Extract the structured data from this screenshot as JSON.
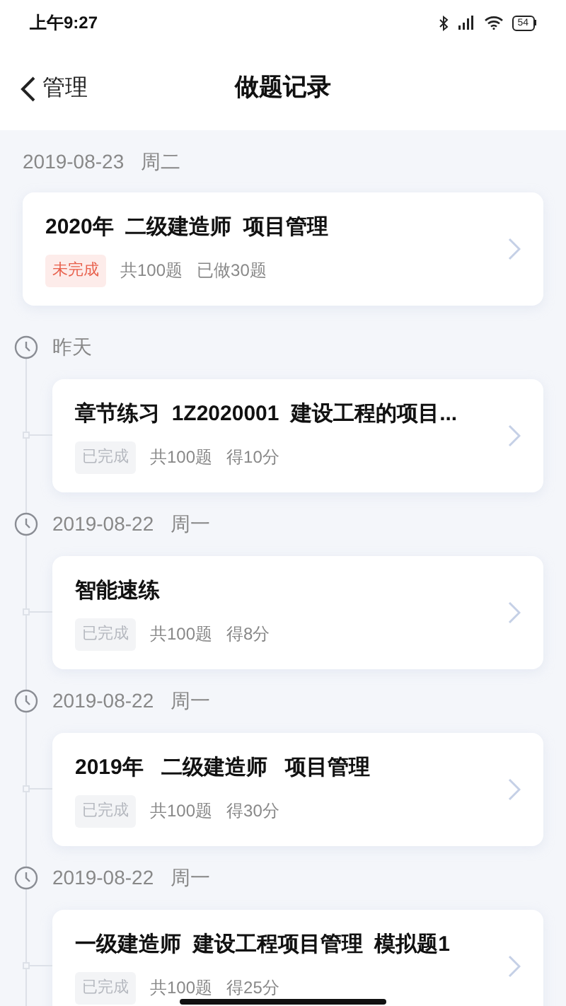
{
  "status_bar": {
    "time": "上午9:27",
    "battery": "54"
  },
  "nav": {
    "back_label": "管理",
    "title": "做题记录"
  },
  "top_group": {
    "date": "2019-08-23",
    "weekday": "周二",
    "card": {
      "title": "2020年  二级建造师  项目管理",
      "status": {
        "text": "未完成",
        "kind": "incomplete"
      },
      "total": "共100题",
      "result": "已做30题"
    }
  },
  "timeline": [
    {
      "date": "昨天",
      "card": {
        "title": "章节练习  1Z2020001  建设工程的项目...",
        "status": {
          "text": "已完成",
          "kind": "complete"
        },
        "total": "共100题",
        "result": "得10分"
      }
    },
    {
      "date": "2019-08-22",
      "weekday": "周一",
      "card": {
        "title": "智能速练",
        "status": {
          "text": "已完成",
          "kind": "complete"
        },
        "total": "共100题",
        "result": "得8分"
      }
    },
    {
      "date": "2019-08-22",
      "weekday": "周一",
      "card": {
        "title": "2019年   二级建造师   项目管理",
        "status": {
          "text": "已完成",
          "kind": "complete"
        },
        "total": "共100题",
        "result": "得30分"
      }
    },
    {
      "date": "2019-08-22",
      "weekday": "周一",
      "card": {
        "title": "一级建造师  建设工程项目管理  模拟题1",
        "status": {
          "text": "已完成",
          "kind": "complete"
        },
        "total": "共100题",
        "result": "得25分"
      }
    }
  ]
}
